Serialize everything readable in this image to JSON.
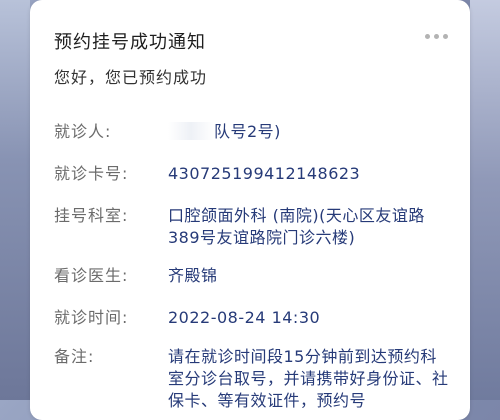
{
  "notification": {
    "title": "预约挂号成功通知",
    "subtitle": "您好，您已预约成功",
    "fields": [
      {
        "label": "就诊人:",
        "value": "队号2号)"
      },
      {
        "label": "就诊卡号:",
        "value": "430725199412148623"
      },
      {
        "label": "挂号科室:",
        "value": "口腔颌面外科 (南院)(天心区友谊路389号友谊路院门诊六楼)"
      },
      {
        "label": "看诊医生:",
        "value": "齐殿锦"
      },
      {
        "label": "就诊时间:",
        "value": "2022-08-24 14:30"
      },
      {
        "label": "备注:",
        "value": "请在就诊时间段15分钟前到达预约科室分诊台取号，并请携带好身份证、社保卡、等有效证件，预约号"
      }
    ]
  },
  "icons": {
    "more": "more-horizontal-icon"
  },
  "colors": {
    "label": "#6b6b6b",
    "value": "#263a78",
    "title": "#1e1e1e"
  }
}
